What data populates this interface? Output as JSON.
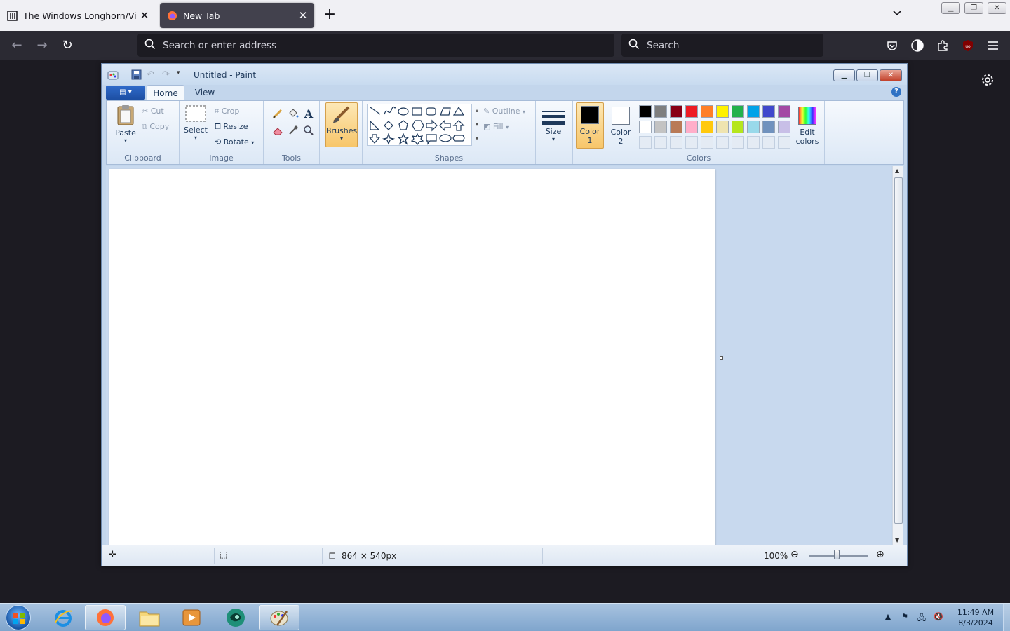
{
  "browser": {
    "tabs": [
      {
        "label": "The Windows Longhorn/Vista A",
        "active": false
      },
      {
        "label": "New Tab",
        "active": true
      }
    ],
    "newtab_label": "+",
    "urlbar": {
      "placeholder": "Search or enter address"
    },
    "searchbar": {
      "placeholder": "Search"
    }
  },
  "paint": {
    "title": "Untitled - Paint",
    "ribbon_tabs": {
      "home": "Home",
      "view": "View"
    },
    "help": "?",
    "clipboard": {
      "paste": "Paste",
      "cut": "Cut",
      "copy": "Copy",
      "group": "Clipboard"
    },
    "image": {
      "select": "Select",
      "crop": "Crop",
      "resize": "Resize",
      "rotate": "Rotate",
      "group": "Image"
    },
    "tools": {
      "group": "Tools"
    },
    "brushes": {
      "label": "Brushes"
    },
    "shapes": {
      "outline": "Outline",
      "fill": "Fill",
      "group": "Shapes"
    },
    "size": {
      "label": "Size"
    },
    "colors": {
      "color1_line1": "Color",
      "color1_line2": "1",
      "color2_line1": "Color",
      "color2_line2": "2",
      "edit_line1": "Edit",
      "edit_line2": "colors",
      "group": "Colors",
      "color1": "#000000",
      "color2": "#ffffff",
      "palette_row1": [
        "#000000",
        "#7f7f7f",
        "#880015",
        "#ed1c24",
        "#ff7f27",
        "#fff200",
        "#22b14c",
        "#00a2e8",
        "#3f48cc",
        "#a349a4"
      ],
      "palette_row2": [
        "#ffffff",
        "#c3c3c3",
        "#b97a57",
        "#ffaec9",
        "#ffc90e",
        "#efe4b0",
        "#b5e61d",
        "#99d9ea",
        "#7092be",
        "#c8bfe7"
      ]
    },
    "status": {
      "dimensions": "864 × 540px",
      "zoom": "100%"
    }
  },
  "taskbar": {
    "time": "11:49 AM",
    "date": "8/3/2024"
  }
}
